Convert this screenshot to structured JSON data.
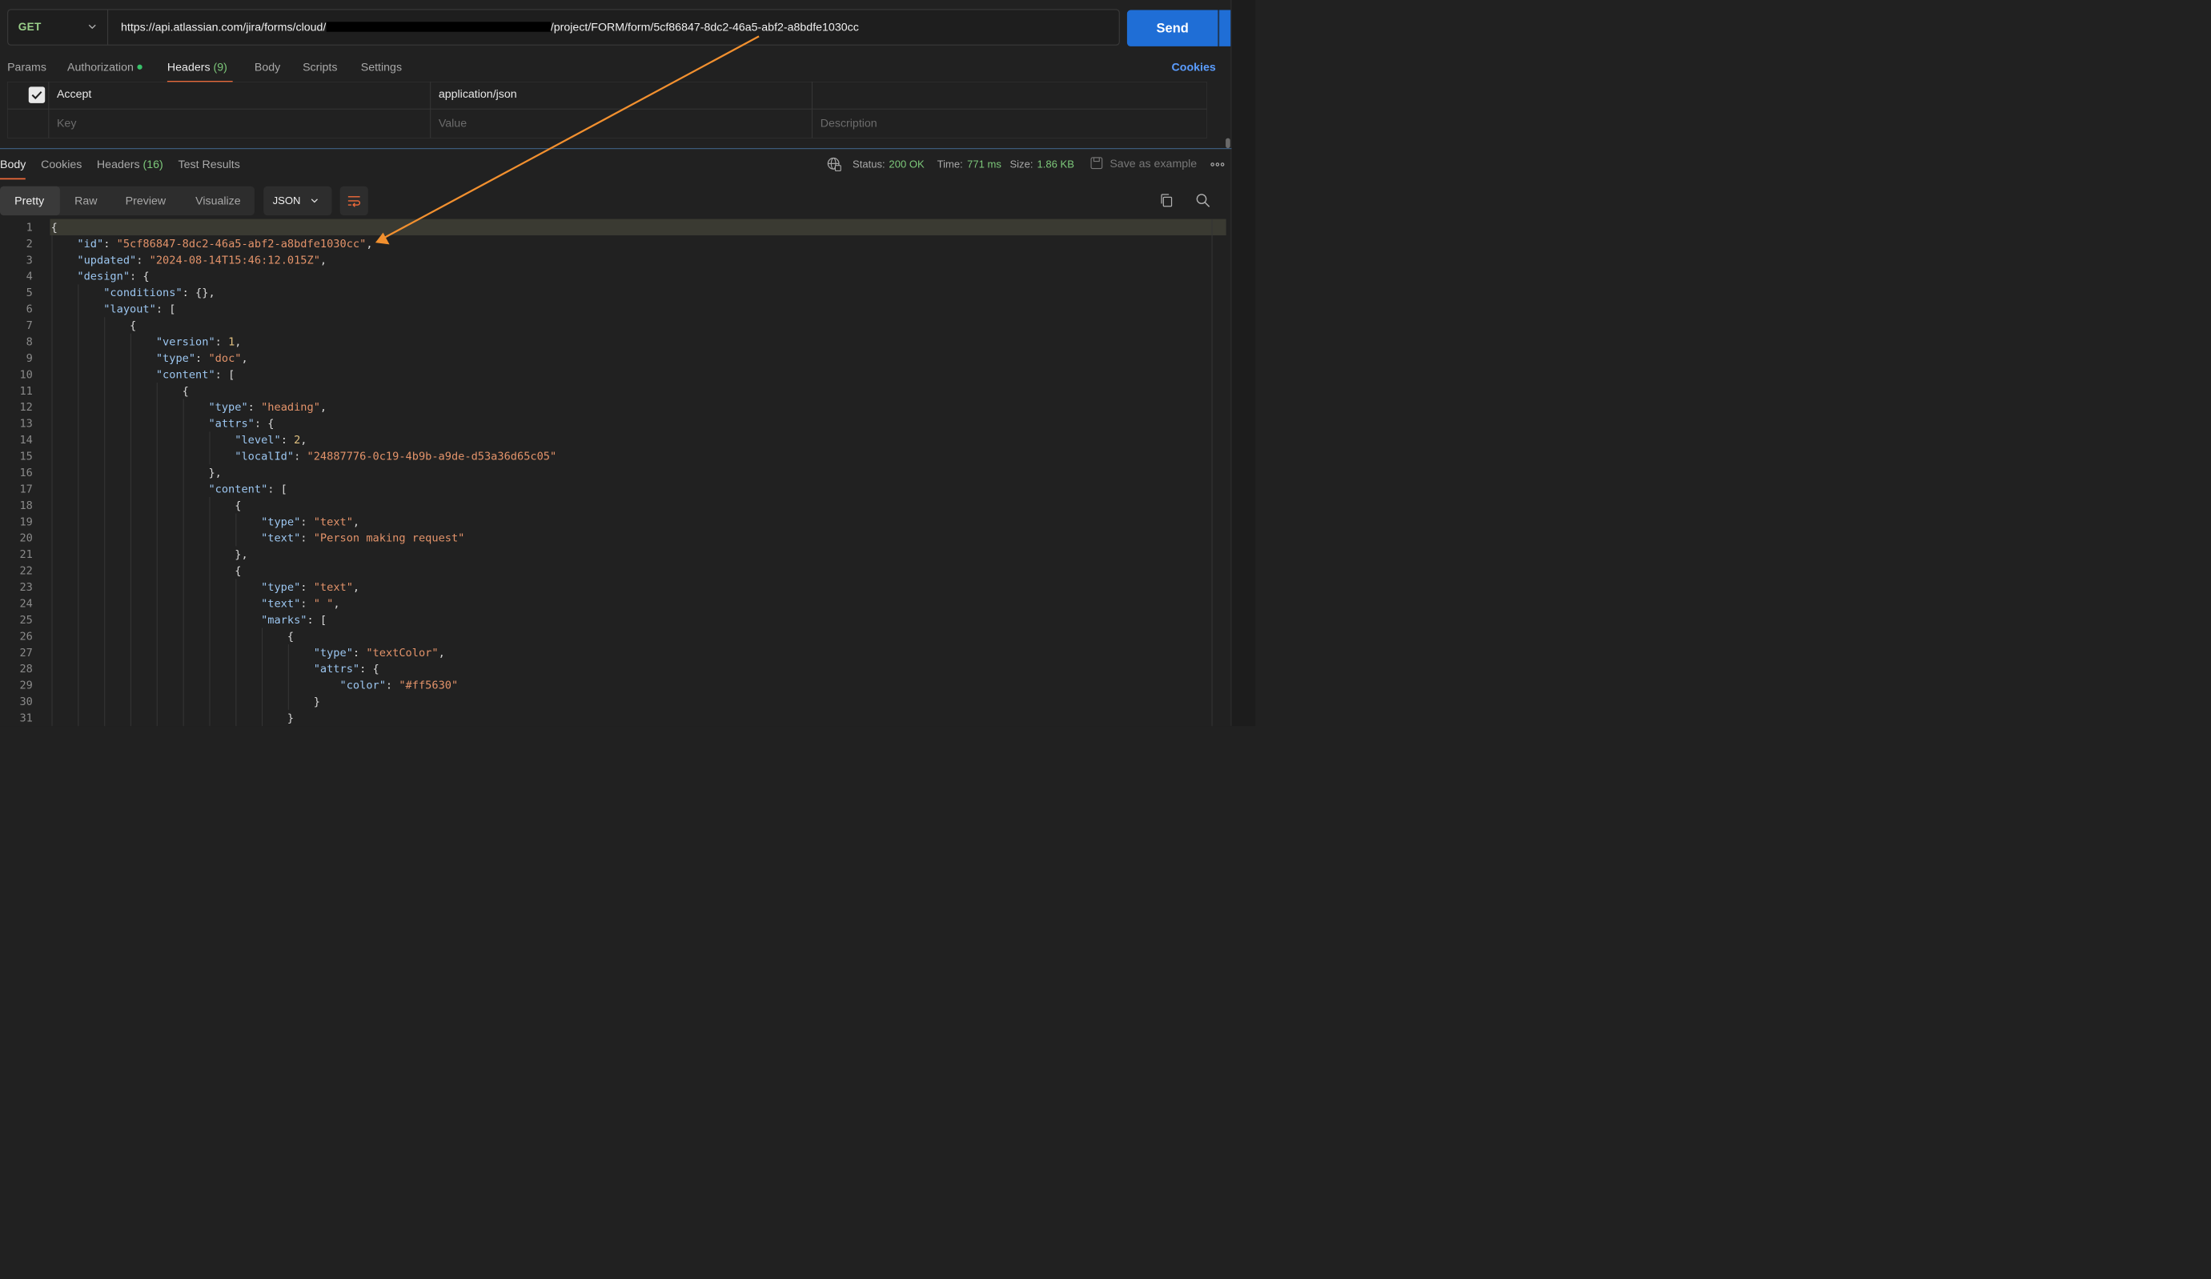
{
  "request": {
    "method": "GET",
    "url_prefix": "https://api.atlassian.com/jira/forms/cloud/",
    "url_suffix": "/project/FORM/form/5cf86847-8dc2-46a5-abf2-a8bdfe1030cc",
    "send_label": "Send"
  },
  "request_tabs": {
    "params": "Params",
    "authorization": "Authorization",
    "headers": "Headers",
    "headers_count": "(9)",
    "body": "Body",
    "scripts": "Scripts",
    "settings": "Settings",
    "cookies": "Cookies"
  },
  "headers_table": {
    "row": {
      "key": "Accept",
      "value": "application/json",
      "checked": true
    },
    "placeholder": {
      "key": "Key",
      "value": "Value",
      "description": "Description"
    }
  },
  "response_tabs": {
    "body": "Body",
    "cookies": "Cookies",
    "headers": "Headers",
    "headers_count": "(16)",
    "test_results": "Test Results"
  },
  "response_status": {
    "status_label": "Status:",
    "status_value": "200 OK",
    "time_label": "Time:",
    "time_value": "771 ms",
    "size_label": "Size:",
    "size_value": "1.86 KB",
    "save_example": "Save as example"
  },
  "view_modes": {
    "pretty": "Pretty",
    "raw": "Raw",
    "preview": "Preview",
    "visualize": "Visualize",
    "format": "JSON"
  },
  "code_lines": [
    "{",
    "    \"id\": \"5cf86847-8dc2-46a5-abf2-a8bdfe1030cc\",",
    "    \"updated\": \"2024-08-14T15:46:12.015Z\",",
    "    \"design\": {",
    "        \"conditions\": {},",
    "        \"layout\": [",
    "            {",
    "                \"version\": 1,",
    "                \"type\": \"doc\",",
    "                \"content\": [",
    "                    {",
    "                        \"type\": \"heading\",",
    "                        \"attrs\": {",
    "                            \"level\": 2,",
    "                            \"localId\": \"24887776-0c19-4b9b-a9de-d53a36d65c05\"",
    "                        },",
    "                        \"content\": [",
    "                            {",
    "                                \"type\": \"text\",",
    "                                \"text\": \"Person making request\"",
    "                            },",
    "                            {",
    "                                \"type\": \"text\",",
    "                                \"text\": \" \",",
    "                                \"marks\": [",
    "                                    {",
    "                                        \"type\": \"textColor\",",
    "                                        \"attrs\": {",
    "                                            \"color\": \"#ff5630\"",
    "                                        }",
    "                                    }"
  ],
  "colors": {
    "accent_blue": "#1f6ed6",
    "tab_underline": "#f26b3a",
    "annotation_arrow": "#f2902f",
    "status_green": "#7dc87a"
  }
}
